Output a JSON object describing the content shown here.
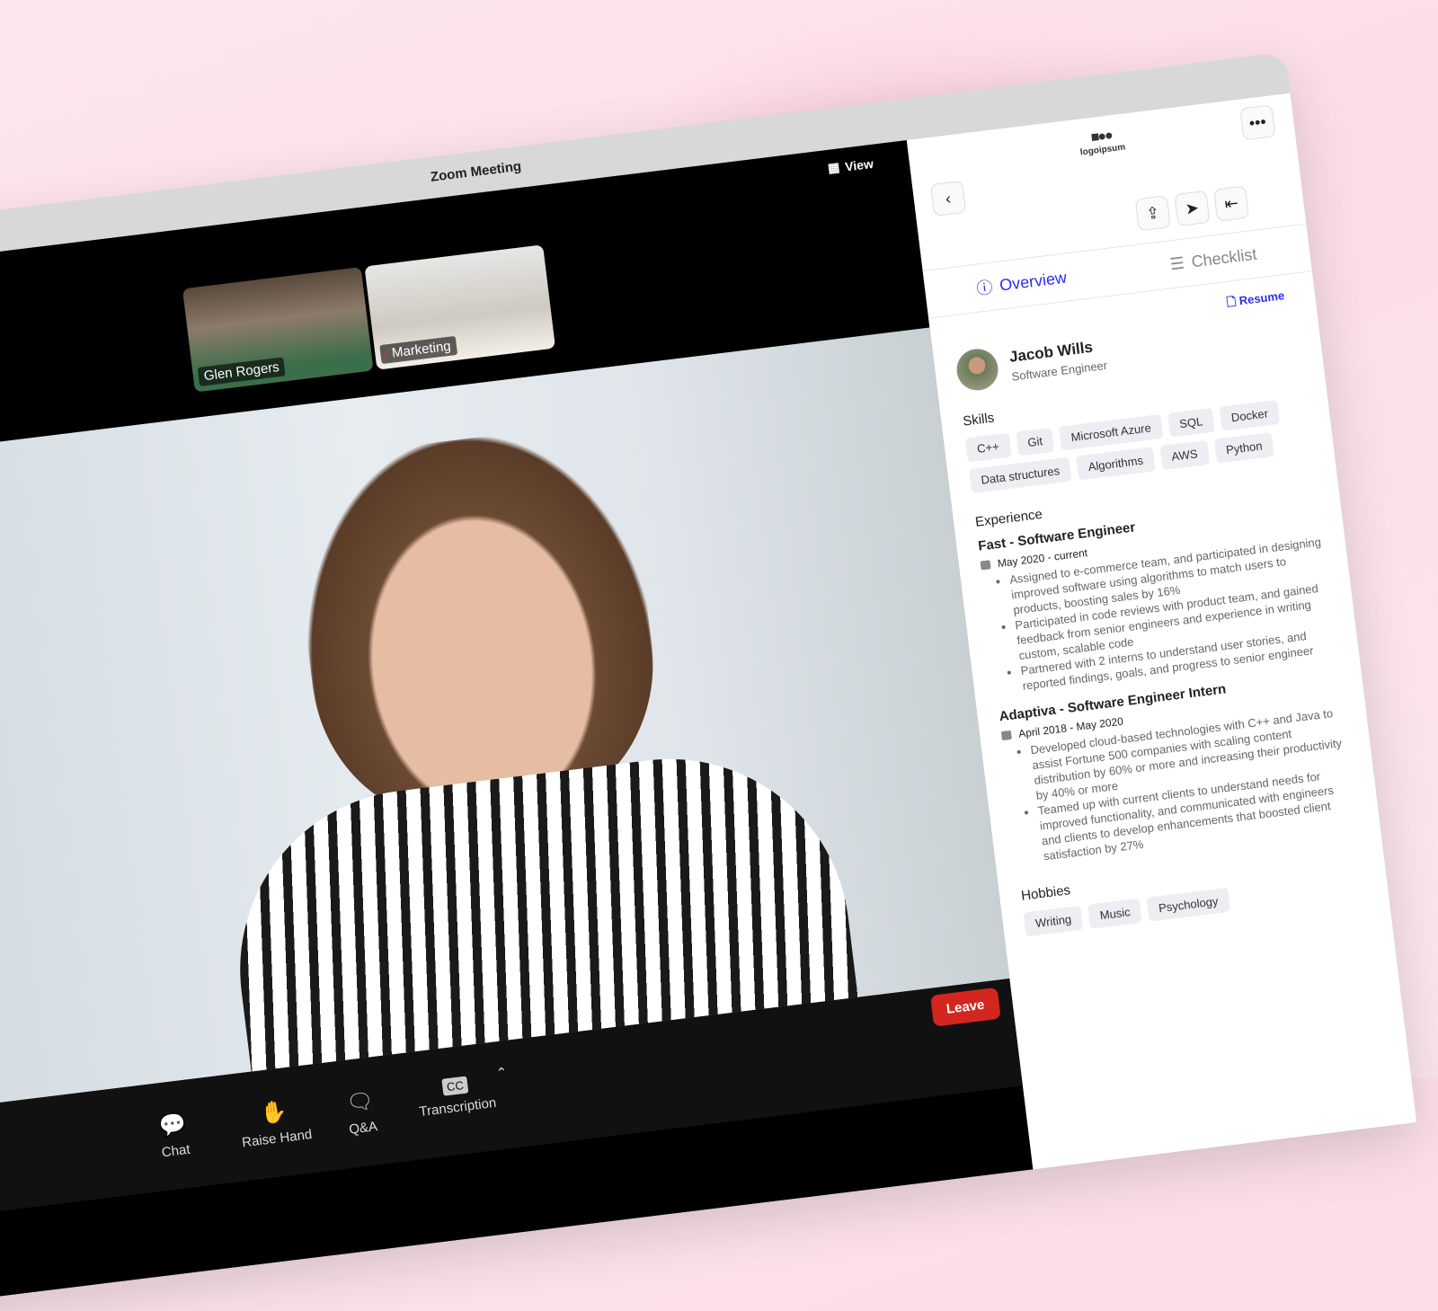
{
  "window": {
    "title": "Zoom Meeting",
    "view_label": "View"
  },
  "participants": [
    {
      "name": "Glen Rogers"
    },
    {
      "name": "Marketing",
      "muted": true
    }
  ],
  "toolbar": {
    "items": [
      {
        "label": "Chat",
        "icon": "chat-bubble-icon"
      },
      {
        "label": "Raise Hand",
        "icon": "hand-icon"
      },
      {
        "label": "Q&A",
        "icon": "qa-bubbles-icon"
      },
      {
        "label": "Transcription",
        "icon": "cc-icon"
      }
    ],
    "leave_label": "Leave",
    "leave_color": "#d3261f"
  },
  "panel": {
    "logo_text": "logoipsum",
    "tabs": [
      {
        "label": "Overview",
        "active": true
      },
      {
        "label": "Checklist",
        "active": false
      }
    ],
    "accent": "#2a2ef0",
    "resume_label": "Resume",
    "candidate": {
      "name": "Jacob Wills",
      "role": "Software Engineer"
    },
    "skills_title": "Skills",
    "skills": [
      "C++",
      "Git",
      "Microsoft Azure",
      "SQL",
      "Docker",
      "Data structures",
      "Algorithms",
      "AWS",
      "Python"
    ],
    "experience_title": "Experience",
    "jobs": [
      {
        "title": "Fast - Software Engineer",
        "dates": "May 2020 - current",
        "bullets": [
          "Assigned to e-commerce team, and participated in designing improved software using algorithms to match users to products, boosting sales by 16%",
          "Participated in code reviews with product team, and gained feedback from senior engineers and experience in writing custom, scalable code",
          "Partnered with 2 interns to understand user stories, and reported findings, goals, and progress to senior engineer"
        ]
      },
      {
        "title": "Adaptiva - Software Engineer Intern",
        "dates": "April 2018 - May 2020",
        "bullets": [
          "Developed cloud-based technologies with C++ and Java to assist Fortune 500 companies with scaling content distribution by 60% or more and increasing their productivity by 40% or more",
          "Teamed up with current clients to understand needs for improved functionality, and communicated with engineers and clients to develop enhancements that boosted client satisfaction by 27%"
        ]
      }
    ],
    "hobbies_title": "Hobbies",
    "hobbies": [
      "Writing",
      "Music",
      "Psychology"
    ]
  }
}
